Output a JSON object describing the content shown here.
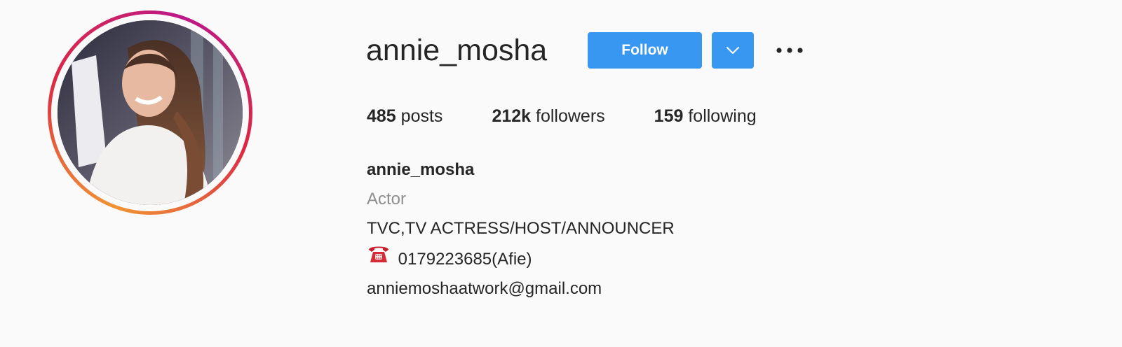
{
  "profile": {
    "username": "annie_mosha",
    "avatar_alt": "profile-photo"
  },
  "actions": {
    "follow_label": "Follow",
    "dropdown_icon": "chevron-down-icon",
    "more_icon": "more-options-icon"
  },
  "stats": {
    "posts_count": "485",
    "posts_label": "posts",
    "followers_count": "212k",
    "followers_label": "followers",
    "following_count": "159",
    "following_label": "following"
  },
  "bio": {
    "full_name": "annie_mosha",
    "category": "Actor",
    "line1": "TVC,TV ACTRESS/HOST/ANNOUNCER",
    "phone_icon": "telephone-icon",
    "phone_text": "0179223685(Afie)",
    "email": "anniemoshaatwork@gmail.com"
  },
  "colors": {
    "accent": "#3897f0",
    "text": "#262626",
    "muted": "#8e8e8e",
    "background": "#fafafa"
  }
}
